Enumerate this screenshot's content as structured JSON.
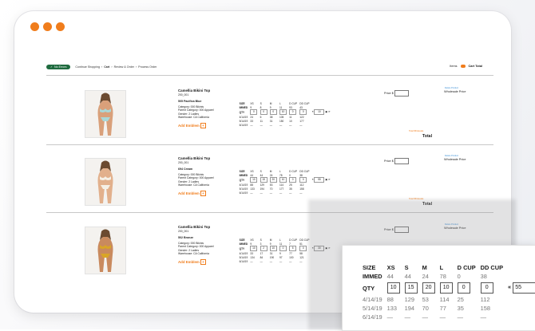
{
  "app": {
    "accent": "#f07d1c",
    "badge_color": "#1f6b3f"
  },
  "topbar": {
    "badge": "No Errors",
    "crumbs": [
      "Continue Shopping",
      "Cart",
      "Review & Order",
      "Process Order"
    ],
    "current_crumb": "Cart",
    "items_label": "Items",
    "cart_total_label": "Cart Total"
  },
  "products": [
    {
      "name": "Camellia Bikini Top",
      "code": "200_001",
      "color": "505 Pacifica Blue",
      "details": [
        "Category: 000 Bikinis",
        "Parent Category: 000 Apparel",
        "Gender: 2 Ladies",
        "Warehouse: CA California"
      ],
      "add_emblem": "Add Emblem",
      "sizes": [
        "SIZE",
        "XS",
        "S",
        "M",
        "L",
        "D CUP",
        "DD CUP"
      ],
      "immed": [
        "IMMED",
        "9",
        "8",
        "9",
        "11",
        "93",
        "43"
      ],
      "qty": [
        "QTY",
        "0",
        "0",
        "0",
        "10",
        "0",
        "0"
      ],
      "qty_all": "10",
      "future": [
        [
          "4/14/19",
          "24",
          "6",
          "38",
          "105",
          "11",
          "122"
        ],
        [
          "5/14/19",
          "33",
          "11",
          "31",
          "150",
          "10",
          "177"
        ],
        [
          "6/14/19",
          "—",
          "—",
          "—",
          "—",
          "—",
          "—"
        ]
      ],
      "price_label": "Price $",
      "wholesale_label": "Wholesale Price",
      "remove_label": "Delete Product",
      "total_small": "Total Wholesale",
      "total_label": "Total"
    },
    {
      "name": "Camellia Bikini Top",
      "code": "200_001",
      "color": "694 Cream",
      "details": [
        "Category: 000 Bikinis",
        "Parent Category: 000 Apparel",
        "Gender: 2 Ladies",
        "Warehouse: CA California"
      ],
      "add_emblem": "Add Emblem",
      "sizes": [
        "SIZE",
        "XS",
        "S",
        "M",
        "L",
        "D CUP",
        "DD CUP"
      ],
      "immed": [
        "IMMED",
        "44",
        "44",
        "24",
        "78",
        "0",
        "38"
      ],
      "qty": [
        "QTY",
        "10",
        "15",
        "20",
        "10",
        "0",
        "0"
      ],
      "qty_all": "55",
      "future": [
        [
          "4/14/19",
          "88",
          "129",
          "53",
          "114",
          "25",
          "112"
        ],
        [
          "5/14/19",
          "133",
          "194",
          "70",
          "177",
          "35",
          "158"
        ],
        [
          "6/14/19",
          "—",
          "—",
          "—",
          "—",
          "—",
          "—"
        ]
      ],
      "price_label": "Price $",
      "wholesale_label": "Wholesale Price",
      "remove_label": "Delete Product",
      "total_small": "Total Wholesale",
      "total_label": "Total"
    },
    {
      "name": "Camellia Bikini Top",
      "code": "200_001",
      "color": "502 Bronze",
      "details": [
        "Category: 000 Bikinis",
        "Parent Category: 000 Apparel",
        "Gender: 2 Ladies",
        "Warehouse: CA California"
      ],
      "add_emblem": "Add Emblem",
      "sizes": [
        "SIZE",
        "XS",
        "S",
        "M",
        "L",
        "D CUP",
        "DD CUP"
      ],
      "immed": [
        "IMMED",
        "9",
        "3",
        "9",
        "11",
        "7",
        "51"
      ],
      "qty": [
        "QTY",
        "10",
        "2",
        "10",
        "0",
        "5",
        "0"
      ],
      "qty_all": "30",
      "future": [
        [
          "4/14/19",
          "33",
          "17",
          "31",
          "9",
          "77",
          "58"
        ],
        [
          "5/14/19",
          "134",
          "84",
          "190",
          "97",
          "100",
          "121"
        ],
        [
          "6/14/19",
          "—",
          "—",
          "—",
          "—",
          "—",
          "—"
        ]
      ],
      "price_label": "Price $",
      "wholesale_label": "Wholesale Price",
      "remove_label": "Delete Product",
      "total_small": "",
      "total_label": ""
    }
  ],
  "zoom": {
    "sizes": [
      "SIZE",
      "XS",
      "S",
      "M",
      "L",
      "D CUP",
      "DD CUP"
    ],
    "immed": [
      "IMMED",
      "44",
      "44",
      "24",
      "78",
      "0",
      "38"
    ],
    "qty": [
      "QTY",
      "10",
      "15",
      "20",
      "10",
      "0",
      "0"
    ],
    "qty_all": "55",
    "future": [
      [
        "4/14/19",
        "88",
        "129",
        "53",
        "114",
        "25",
        "112"
      ],
      [
        "5/14/19",
        "133",
        "194",
        "70",
        "77",
        "35",
        "158"
      ],
      [
        "6/14/19",
        "—",
        "—",
        "—",
        "—",
        "—",
        "—"
      ]
    ],
    "fill_icon": "«",
    "icons": [
      "save-icon",
      "refresh-icon"
    ]
  }
}
